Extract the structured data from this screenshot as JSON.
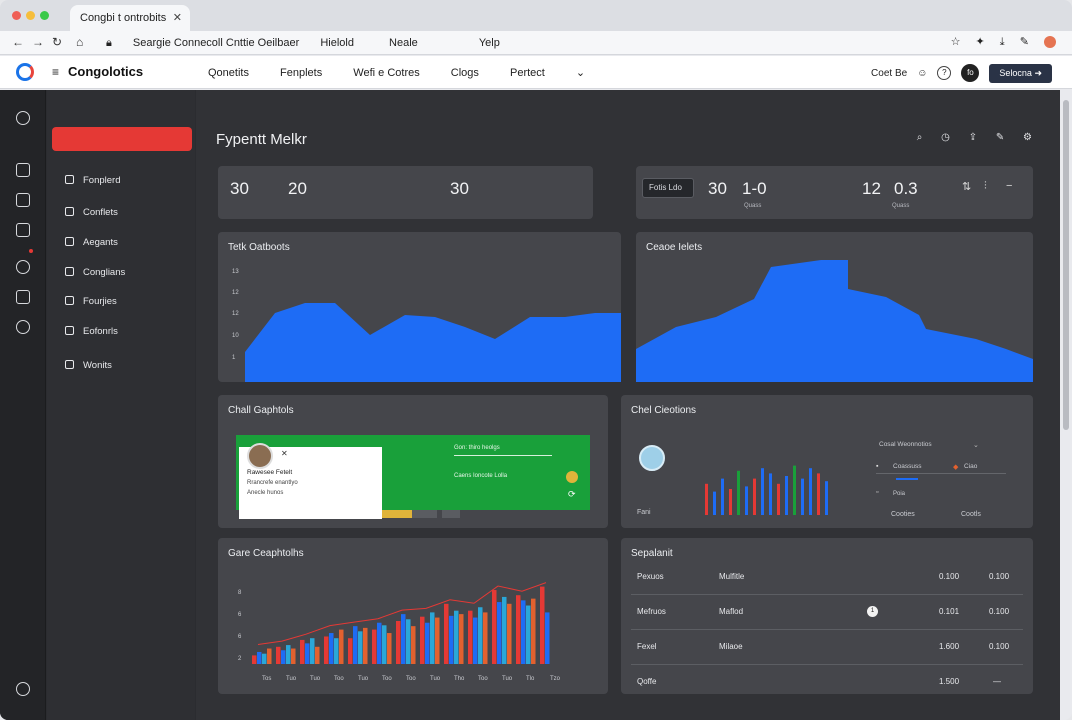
{
  "browser": {
    "tab_title": "Congbi t ontrobits",
    "url_parts": [
      "Seargie Connecoll Cnttie Oeilbaer",
      "Hielold",
      "Neale",
      "Yelp"
    ]
  },
  "app": {
    "name": "Congolotics",
    "nav": [
      "Qonetits",
      "Fenplets",
      "Wefi e Cotres",
      "Clogs",
      "Pertect"
    ],
    "header_right": {
      "user": "Coet Be",
      "avatar_text": "fo",
      "button": "Selocna"
    }
  },
  "sidebar": {
    "items": [
      "Fonplerd",
      "Conflets",
      "Aegants",
      "Conglians",
      "Fourjies",
      "Eofonrls",
      "Wonits"
    ]
  },
  "page": {
    "title": "Fypentt Melkr"
  },
  "stats": {
    "left": [
      "30",
      "20",
      "30"
    ],
    "right": {
      "button": "Fotis Ldo",
      "v1": "30",
      "v2": "1-0",
      "v3": "12",
      "v4": "0.3",
      "cap1": "Quass",
      "cap2": "Quass"
    }
  },
  "charts": {
    "area1_title": "Tetk Oatboots",
    "area1_ticks": [
      "13",
      "12",
      "12",
      "10",
      "1"
    ],
    "area2_title": "Ceaoe Ielets",
    "panel1_title": "Chall Gaphtols",
    "panel1_text": [
      "Rawesee Fetelt",
      "Rrancrefe enantlyo",
      "Gon: thiro heolgs",
      "Anecle hunos",
      "Caens Ioncote Lolla"
    ],
    "panel2_title": "Chel Cieotions",
    "panel2_left": "Fani",
    "panel2_legend": [
      "Cosal Weonnotios",
      "Coassuss",
      "Poia",
      "Ciao"
    ],
    "panel2_bottom": [
      "Cooties",
      "Cootls"
    ],
    "bar_title": "Gare Ceaphtolhs",
    "bar_xlabels": [
      "Tos",
      "Tuo",
      "Tuo",
      "Too",
      "Tuo",
      "Too",
      "Too",
      "Tuo",
      "Tho",
      "Too",
      "Tuo",
      "Tlo",
      "Tzo"
    ],
    "bar_yticks": [
      "8",
      "6",
      "6",
      "2"
    ],
    "table_title": "Sepalanit",
    "table_rows": [
      [
        "Pexuos",
        "Mulfitle",
        "",
        "0.100",
        "0.100"
      ],
      [
        "Mefruos",
        "Maflod",
        "1",
        "0.101",
        "0.100"
      ],
      [
        "Fexel",
        "Milaoe",
        "",
        "1.600",
        "0.100"
      ],
      [
        "Qoffe",
        "",
        "",
        "1.500",
        "—"
      ]
    ]
  },
  "colors": {
    "accent": "#1e6cf5",
    "danger": "#e53935",
    "green": "#19a03a"
  }
}
